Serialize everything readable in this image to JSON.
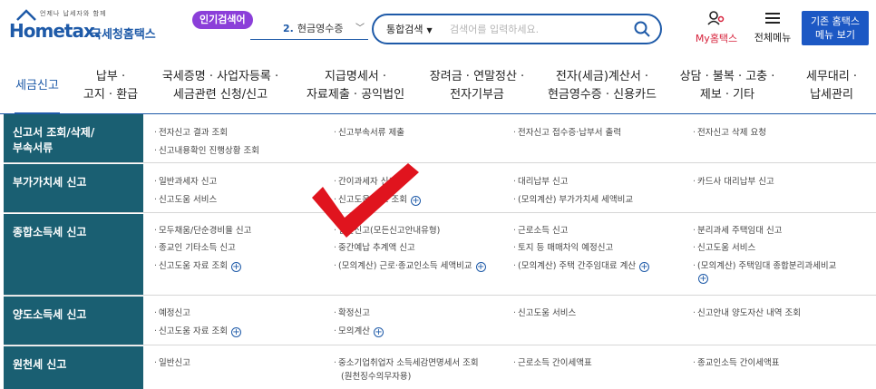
{
  "header": {
    "logo_tagline": "언제나 납세자와 함께",
    "logo_brand": "Hometax.",
    "logo_name": "국세청홈택스",
    "popular_badge": "인기검색어",
    "popular_item_num": "2.",
    "popular_item_text": "현금영수증",
    "search_category": "통합검색",
    "search_placeholder": "검색어를 입력하세요.",
    "my_hometax": "My홈택스",
    "all_menu": "전체메뉴",
    "legacy_line1": "기존 홈택스",
    "legacy_line2": "메뉴 보기"
  },
  "nav": [
    {
      "label": "세금신고"
    },
    {
      "label": "납부 ·\n고지 · 환급"
    },
    {
      "label": "국세증명 · 사업자등록 ·\n세금관련 신청/신고"
    },
    {
      "label": "지급명세서 ·\n자료제출 · 공익법인"
    },
    {
      "label": "장려금 · 연말정산 ·\n전자기부금"
    },
    {
      "label": "전자(세금)계산서 ·\n현금영수증 · 신용카드"
    },
    {
      "label": "상담 · 불복 · 고충 ·\n제보 · 기타"
    },
    {
      "label": "세무대리 ·\n납세관리"
    }
  ],
  "rows": [
    {
      "title": "신고서 조회/삭제/\n부속서류",
      "links": [
        "전자신고 결과 조회",
        "신고부속서류 제출",
        "전자신고 접수증·납부서 출력",
        "전자신고 삭제 요청",
        "신고내용확인 진행상황 조회"
      ]
    },
    {
      "title": "부가가치세 신고",
      "links": [
        "일반과세자 신고",
        "간이과세자 신고",
        "대리납부 신고",
        "카드사 대리납부 신고",
        "신고도움 서비스",
        "신고도움 자료 조회",
        "(모의계산) 부가가치세 세액비교"
      ]
    },
    {
      "title": "종합소득세 신고",
      "links": [
        "모두채움/단순경비율 신고",
        "일반신고(모든신고안내유형)",
        "근로소득 신고",
        "분리과세 주택임대 신고",
        "종교인 기타소득 신고",
        "중간예납 추계액 신고",
        "토지 등 매매차익 예정신고",
        "신고도움 서비스",
        "신고도움 자료 조회",
        "(모의계산) 근로·종교인소득 세액비교",
        "(모의계산) 주택 간주임대료 계산",
        "(모의계산) 주택임대 종합분리과세비교"
      ]
    },
    {
      "title": "양도소득세 신고",
      "links": [
        "예정신고",
        "확정신고",
        "신고도움 서비스",
        "신고안내 양도자산 내역 조회",
        "신고도움 자료 조회",
        "모의계산"
      ]
    },
    {
      "title": "원천세 신고",
      "links": [
        "일반신고",
        "중소기업취업자 소득세감면명세서 조회",
        "(원천징수의무자용)",
        "근로소득 간이세액표",
        "종교인소득 간이세액표"
      ]
    }
  ]
}
